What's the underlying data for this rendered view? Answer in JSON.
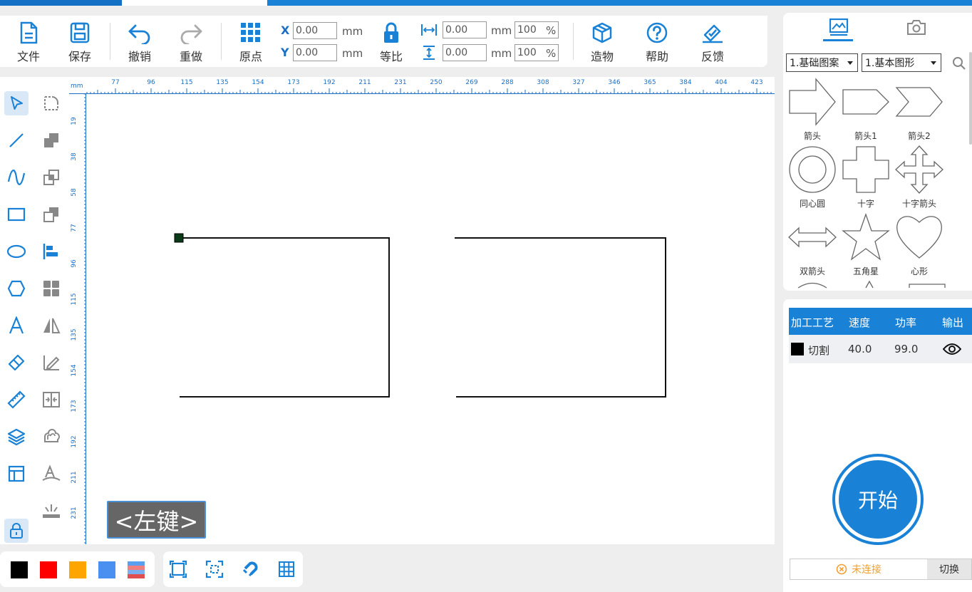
{
  "toolbar": {
    "file": "文件",
    "save": "保存",
    "undo": "撤销",
    "redo": "重做",
    "origin": "原点",
    "proportional": "等比",
    "build": "造物",
    "help": "帮助",
    "feedback": "反馈",
    "x_label": "X",
    "y_label": "Y",
    "x_value": "0.00",
    "y_value": "0.00",
    "width_value": "0.00",
    "height_value": "0.00",
    "width_pct": "100",
    "height_pct": "100",
    "unit": "mm",
    "pct_sign": "%"
  },
  "ruler": {
    "unit": "mm",
    "h_ticks": [
      "77",
      "96",
      "115",
      "135",
      "154",
      "173",
      "192",
      "211",
      "231",
      "250",
      "269",
      "288",
      "308",
      "327",
      "346",
      "365",
      "384",
      "404",
      "423"
    ],
    "v_ticks": [
      "19",
      "38",
      "58",
      "77",
      "96",
      "115",
      "135",
      "154",
      "173",
      "192",
      "211",
      "231"
    ]
  },
  "canvas": {
    "mouse_hint": "<左键>"
  },
  "colors": {
    "accent": "#1a82d6",
    "swatches": [
      "#000000",
      "#ff0000",
      "#ffa500",
      "#4a90f0"
    ]
  },
  "library": {
    "category": "1.基础图案",
    "subcategory": "1.基本图形",
    "shapes": [
      {
        "label": "箭头"
      },
      {
        "label": "箭头1"
      },
      {
        "label": "箭头2"
      },
      {
        "label": "同心圆"
      },
      {
        "label": "十字"
      },
      {
        "label": "十字箭头"
      },
      {
        "label": "双箭头"
      },
      {
        "label": "五角星"
      },
      {
        "label": "心形"
      }
    ]
  },
  "process": {
    "headers": [
      "加工工艺",
      "速度",
      "功率",
      "输出"
    ],
    "rows": [
      {
        "color": "#000000",
        "name": "切割",
        "speed": "40.0",
        "power": "99.0"
      }
    ],
    "start": "开始",
    "status": "未连接",
    "switch": "切换"
  }
}
